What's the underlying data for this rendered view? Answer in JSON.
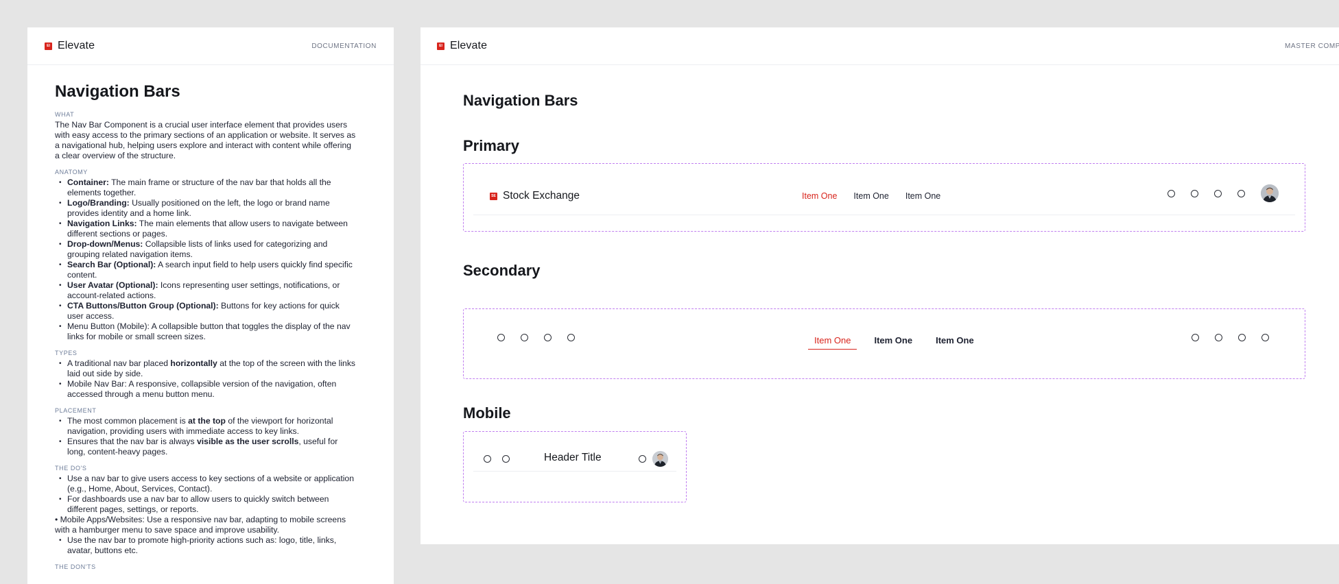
{
  "doc": {
    "brand": "Elevate",
    "logo_text": "EI",
    "header_label": "DOCUMENTATION",
    "title": "Navigation Bars",
    "what": {
      "label": "WHAT",
      "text": "The Nav Bar Component is a crucial user interface element that provides users with easy access to the primary sections of an application or website. It serves as a navigational hub, helping users explore and interact with content while offering a clear overview of the structure."
    },
    "anatomy": {
      "label": "ANATOMY",
      "items": [
        {
          "term": "Container:",
          "desc": " The main frame or structure of the nav bar that holds all the elements together."
        },
        {
          "term": "Logo/Branding:",
          "desc": " Usually positioned on the left, the logo or brand name provides identity and a home link."
        },
        {
          "term": "Navigation Links:",
          "desc": " The main elements that allow users to navigate between different sections or pages."
        },
        {
          "term": "Drop-down/Menus:",
          "desc": " Collapsible lists of links used for categorizing and grouping related navigation items."
        },
        {
          "term": "Search Bar (Optional):",
          "desc": " A search input field to help users quickly find specific content."
        },
        {
          "term": "User Avatar (Optional):",
          "desc": " Icons representing user settings, notifications, or account-related actions."
        },
        {
          "term": "CTA Buttons/Button Group (Optional):",
          "desc": " Buttons for key actions for quick user access."
        },
        {
          "term": "",
          "desc": "Menu Button (Mobile): A collapsible button that toggles the display of the nav links for mobile or small screen sizes."
        }
      ]
    },
    "types": {
      "label": "TYPES",
      "items": [
        {
          "pre": "A traditional nav bar placed ",
          "bold": "horizontally",
          "post": " at the top of the screen with the links laid out side by side."
        },
        {
          "pre": "Mobile Nav Bar: A responsive, collapsible version of the navigation, often accessed through a menu button menu.",
          "bold": "",
          "post": ""
        }
      ]
    },
    "placement": {
      "label": "PLACEMENT",
      "items": [
        {
          "pre": "The most common placement is ",
          "bold": "at the top",
          "post": " of the viewport for horizontal navigation, providing users with immediate access to key links."
        },
        {
          "pre": "Ensures that the nav bar is always ",
          "bold": "visible as the user scrolls",
          "post": ", useful for long, content-heavy pages."
        }
      ]
    },
    "dos": {
      "label": "THE DO'S",
      "items": [
        {
          "text": "Use a nav bar to give users access to key sections of a website or application (e.g., Home, About, Services, Contact).",
          "flush": false
        },
        {
          "text": "For dashboards use a nav bar to allow users to quickly switch between different pages, settings, or reports.",
          "flush": false
        },
        {
          "text": "• Mobile Apps/Websites: Use a responsive nav bar, adapting to mobile screens with a hamburger menu to save space and improve usability.",
          "flush": true
        },
        {
          "text": "Use the nav bar to promote high-priority actions such as: logo, title, links, avatar, buttons etc.",
          "flush": false
        }
      ]
    },
    "donts": {
      "label": "THE DON'TS"
    }
  },
  "master": {
    "brand": "Elevate",
    "logo_text": "EI",
    "header_label": "MASTER COMPONENTS",
    "title": "Navigation Bars",
    "primary": {
      "heading": "Primary",
      "logo_text": "SE",
      "brand": "Stock Exchange",
      "links": [
        "Item One",
        "Item One",
        "Item One"
      ],
      "active_index": 0,
      "accent": "#d8241c"
    },
    "secondary": {
      "heading": "Secondary",
      "links": [
        "Item One",
        "Item One",
        "Item One"
      ],
      "active_index": 0
    },
    "mobile": {
      "heading": "Mobile",
      "title": "Header Title"
    },
    "frame_color": "#c07ef0"
  }
}
